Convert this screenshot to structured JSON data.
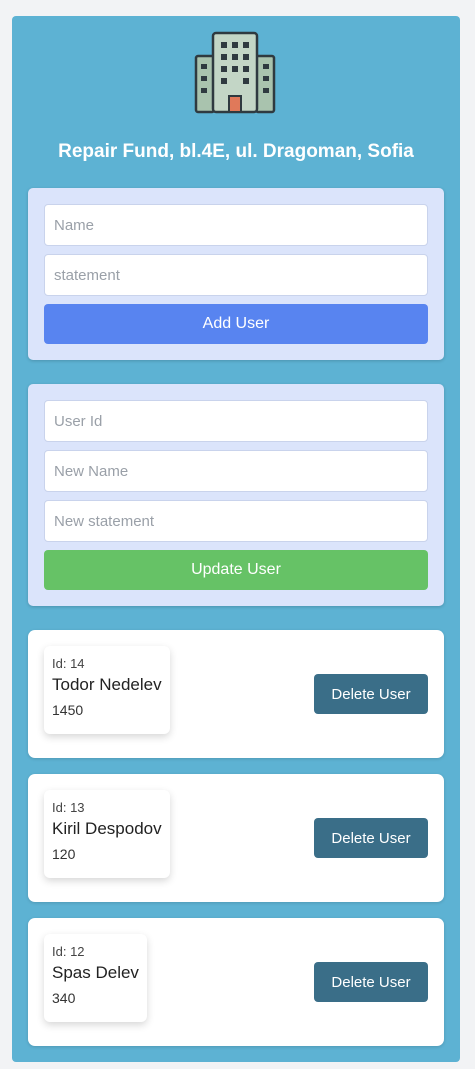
{
  "app": {
    "title": "Repair Fund, bl.4E, ul. Dragoman, Sofia",
    "logo_icon": "building-icon"
  },
  "add_form": {
    "name_placeholder": "Name",
    "statement_placeholder": "statement",
    "submit_label": "Add User"
  },
  "update_form": {
    "id_placeholder": "User Id",
    "name_placeholder": "New Name",
    "statement_placeholder": "New statement",
    "submit_label": "Update User"
  },
  "users": [
    {
      "id_label": "Id: 14",
      "name": "Todor Nedelev",
      "statement": "1450",
      "delete_label": "Delete User"
    },
    {
      "id_label": "Id: 13",
      "name": "Kiril Despodov",
      "statement": "120",
      "delete_label": "Delete User"
    },
    {
      "id_label": "Id: 12",
      "name": "Spas Delev",
      "statement": "340",
      "delete_label": "Delete User"
    }
  ],
  "colors": {
    "background": "#f2f3f5",
    "panel": "#5db2d3",
    "form_card": "#dbe4fb",
    "add_button": "#5884f0",
    "update_button": "#66c266",
    "delete_button": "#3a6e88"
  }
}
